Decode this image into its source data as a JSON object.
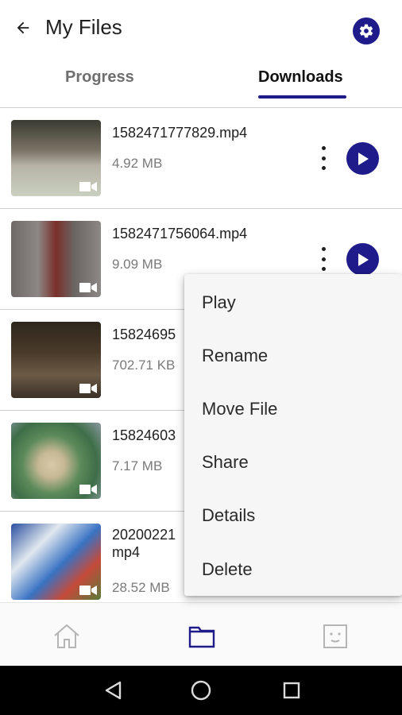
{
  "header": {
    "title": "My Files",
    "back_icon": "arrow-left-icon",
    "settings_icon": "gear-icon"
  },
  "tabs": [
    {
      "label": "Progress",
      "active": false
    },
    {
      "label": "Downloads",
      "active": true
    }
  ],
  "files": [
    {
      "name": "1582471777829.mp4",
      "size": "4.92 MB"
    },
    {
      "name": "1582471756064.mp4",
      "size": "9.09 MB"
    },
    {
      "name": "15824695",
      "size": "702.71 KB"
    },
    {
      "name": "15824603",
      "size": "7.17 MB"
    },
    {
      "name": "20200221",
      "name_line2": "mp4",
      "size": "28.52 MB"
    }
  ],
  "context_menu": {
    "items": [
      "Play",
      "Rename",
      "Move File",
      "Share",
      "Details",
      "Delete"
    ]
  },
  "bottom_nav": [
    {
      "icon": "home-icon",
      "active": false
    },
    {
      "icon": "folder-icon",
      "active": true
    },
    {
      "icon": "profile-icon",
      "active": false
    }
  ],
  "colors": {
    "accent": "#1f1b8a",
    "divider": "#cfcfcf",
    "secondary_text": "#7a7a7a"
  }
}
